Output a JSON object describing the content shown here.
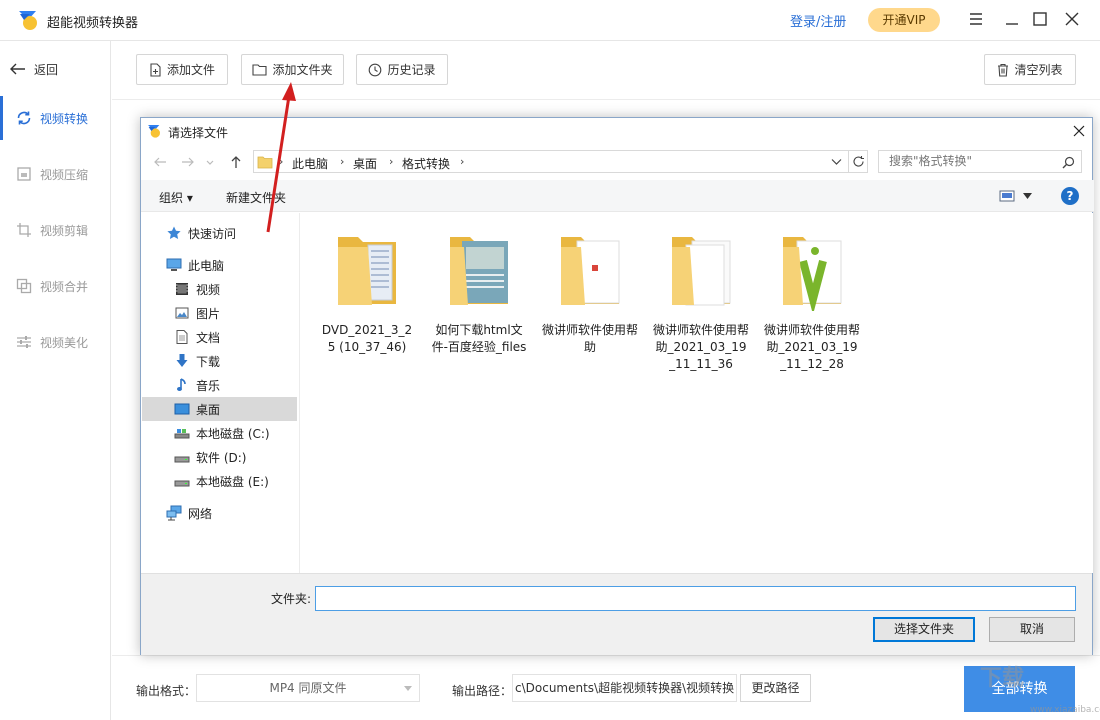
{
  "app": {
    "title": "超能视频转换器",
    "login": "登录/注册",
    "vip": "开通VIP",
    "accent": "#2a6fd6"
  },
  "sidebar": {
    "back": "返回",
    "items": [
      {
        "label": "视频转换",
        "icon": "refresh-icon",
        "active": true
      },
      {
        "label": "视频压缩",
        "icon": "compress-icon"
      },
      {
        "label": "视频剪辑",
        "icon": "crop-icon"
      },
      {
        "label": "视频合并",
        "icon": "merge-icon"
      },
      {
        "label": "视频美化",
        "icon": "sliders-icon"
      }
    ]
  },
  "toolbar": {
    "add_file": "添加文件",
    "add_folder": "添加文件夹",
    "history": "历史记录",
    "clear_list": "清空列表"
  },
  "bottom": {
    "format_label": "输出格式：",
    "format_value": "MP4 同原文件",
    "path_label": "输出路径：",
    "path_value": "c\\Documents\\超能视频转换器\\视频转换",
    "change_path": "更改路径",
    "convert_all": "全部转换"
  },
  "dialog": {
    "title": "请选择文件",
    "breadcrumb": [
      "此电脑",
      "桌面",
      "格式转换"
    ],
    "search_placeholder": "搜索\"格式转换\"",
    "organize": "组织 ▾",
    "new_folder": "新建文件夹",
    "help": "?",
    "nav": [
      {
        "label": "快速访问",
        "icon": "star-icon"
      },
      {
        "label": "此电脑",
        "icon": "computer-icon"
      },
      {
        "label": "视频",
        "icon": "video-folder-icon"
      },
      {
        "label": "图片",
        "icon": "picture-folder-icon"
      },
      {
        "label": "文档",
        "icon": "document-folder-icon"
      },
      {
        "label": "下载",
        "icon": "download-icon"
      },
      {
        "label": "音乐",
        "icon": "music-icon"
      },
      {
        "label": "桌面",
        "icon": "desktop-icon",
        "selected": true
      },
      {
        "label": "本地磁盘 (C:)",
        "icon": "drive-icon"
      },
      {
        "label": "软件 (D:)",
        "icon": "drive-icon"
      },
      {
        "label": "本地磁盘 (E:)",
        "icon": "drive-icon"
      },
      {
        "label": "网络",
        "icon": "network-icon"
      }
    ],
    "files": [
      {
        "name": "DVD_2021_3_25 (10_37_46)"
      },
      {
        "name": "如何下载html文件-百度经验_files"
      },
      {
        "name": "微讲师软件使用帮助"
      },
      {
        "name": "微讲师软件使用帮助_2021_03_19_11_11_36"
      },
      {
        "name": "微讲师软件使用帮助_2021_03_19_11_12_28"
      }
    ],
    "folder_label": "文件夹:",
    "folder_value": "",
    "select_button": "选择文件夹",
    "cancel_button": "取消"
  },
  "watermark": {
    "text": "下载",
    "url": "www.xiazaiba.com"
  }
}
